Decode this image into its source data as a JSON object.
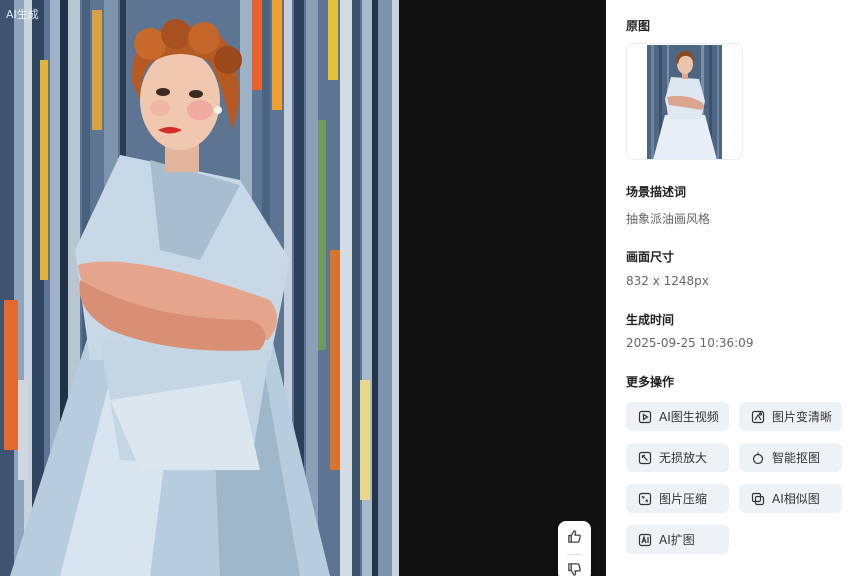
{
  "viewer": {
    "ai_label": "AI生成"
  },
  "feedback": {
    "like_icon": "thumbs-up-icon",
    "dislike_icon": "thumbs-down-icon"
  },
  "panel": {
    "original": {
      "title": "原图"
    },
    "scene": {
      "title": "场景描述词",
      "value": "抽象派油画风格"
    },
    "size": {
      "title": "画面尺寸",
      "value": "832 x 1248px"
    },
    "time": {
      "title": "生成时间",
      "value": "2025-09-25 10:36:09"
    },
    "more": {
      "title": "更多操作",
      "actions": [
        {
          "label": "AI图生视频",
          "icon": "video-icon"
        },
        {
          "label": "图片变清晰",
          "icon": "sharpen-icon"
        },
        {
          "label": "无损放大",
          "icon": "upscale-icon"
        },
        {
          "label": "智能抠图",
          "icon": "cutout-icon"
        },
        {
          "label": "图片压缩",
          "icon": "compress-icon"
        },
        {
          "label": "AI相似图",
          "icon": "similar-icon"
        },
        {
          "label": "AI扩图",
          "icon": "expand-icon"
        }
      ]
    }
  },
  "colors": {
    "panel_bg": "#ffffff",
    "viewer_bg": "#111111",
    "button_bg": "#eef1f6",
    "title_text": "#222222",
    "value_text": "#666666"
  }
}
